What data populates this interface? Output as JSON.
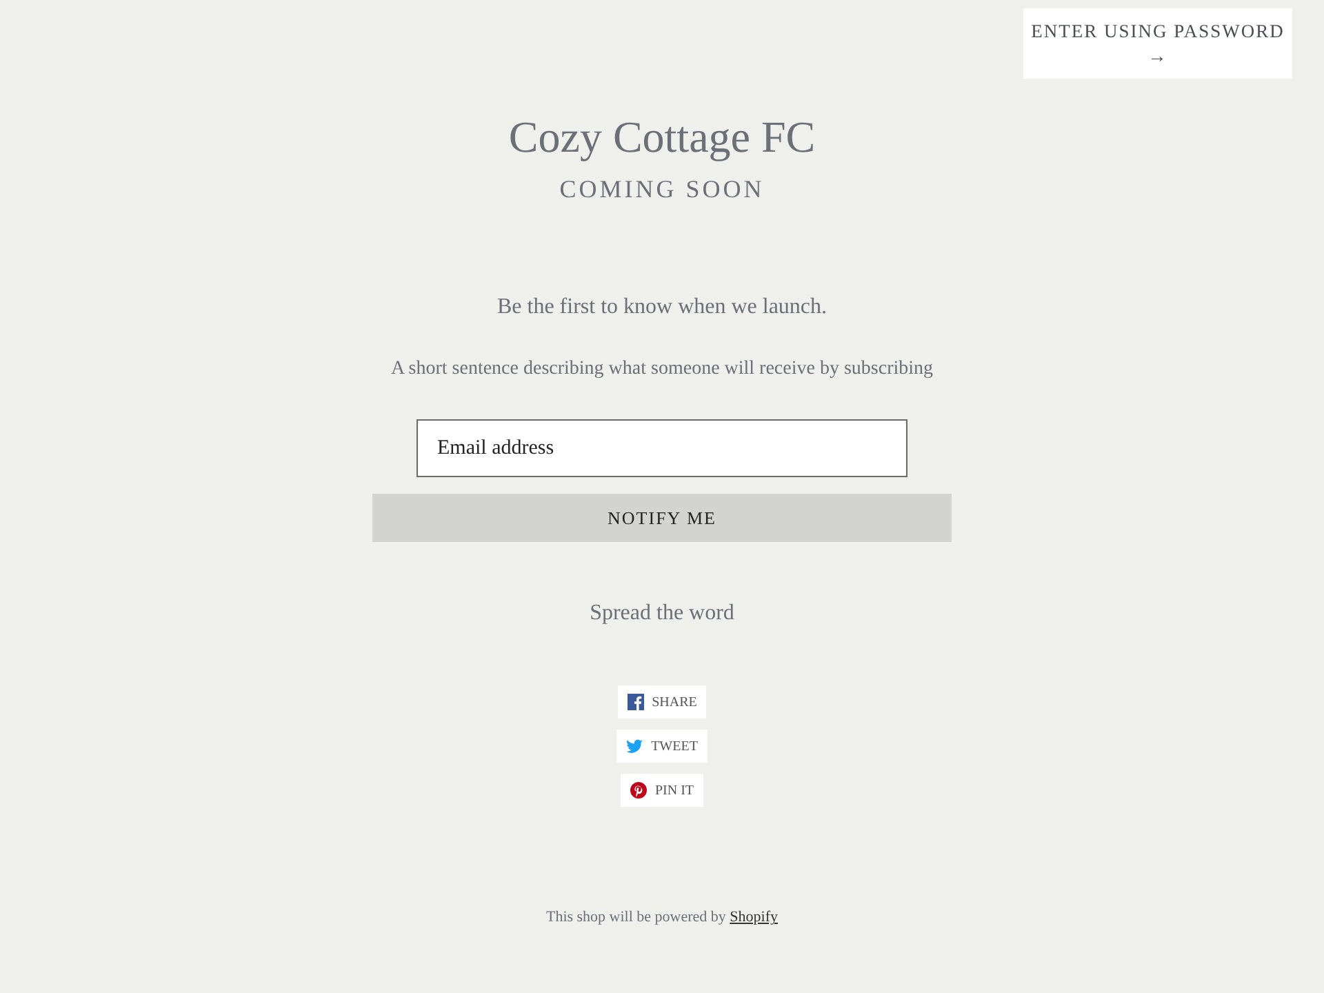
{
  "password_button": {
    "label": "ENTER USING PASSWORD",
    "arrow": "→"
  },
  "header": {
    "title": "Cozy Cottage FC",
    "subtitle": "COMING SOON"
  },
  "signup": {
    "heading": "Be the first to know when we launch.",
    "description": "A short sentence describing what someone will receive by subscribing",
    "email": {
      "placeholder": "Email address"
    },
    "button": "NOTIFY ME"
  },
  "share": {
    "heading": "Spread the word",
    "buttons": [
      {
        "kind": "facebook",
        "label": "SHARE"
      },
      {
        "kind": "twitter",
        "label": "TWEET"
      },
      {
        "kind": "pinterest",
        "label": "PIN IT"
      }
    ]
  },
  "footer": {
    "text": "This shop will be powered by",
    "link": "Shopify"
  }
}
